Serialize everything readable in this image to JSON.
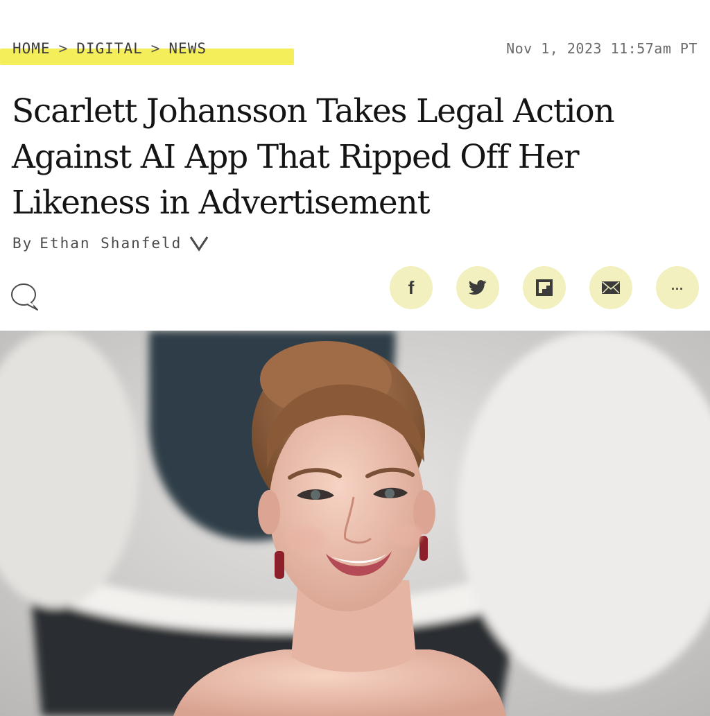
{
  "breadcrumb": {
    "items": [
      {
        "label": "HOME"
      },
      {
        "label": "DIGITAL"
      },
      {
        "label": "NEWS"
      }
    ],
    "separator": ">",
    "highlight_color": "#f4ee5a"
  },
  "article": {
    "timestamp": "Nov 1, 2023 11:57am PT",
    "headline": "Scarlett Johansson Takes Legal Action Against AI App That Ripped Off Her Likeness in Advertisement",
    "byline_prefix": "By",
    "author": "Ethan Shanfeld"
  },
  "share": {
    "button_color": "#f2f0bf",
    "buttons": [
      {
        "icon": "facebook-icon",
        "glyph": "f"
      },
      {
        "icon": "twitter-icon"
      },
      {
        "icon": "flipboard-icon"
      },
      {
        "icon": "email-icon"
      },
      {
        "icon": "more-icon",
        "glyph": "..."
      }
    ]
  },
  "icons": {
    "comment": "comment-icon",
    "author_dropdown": "chevron-down-icon"
  }
}
